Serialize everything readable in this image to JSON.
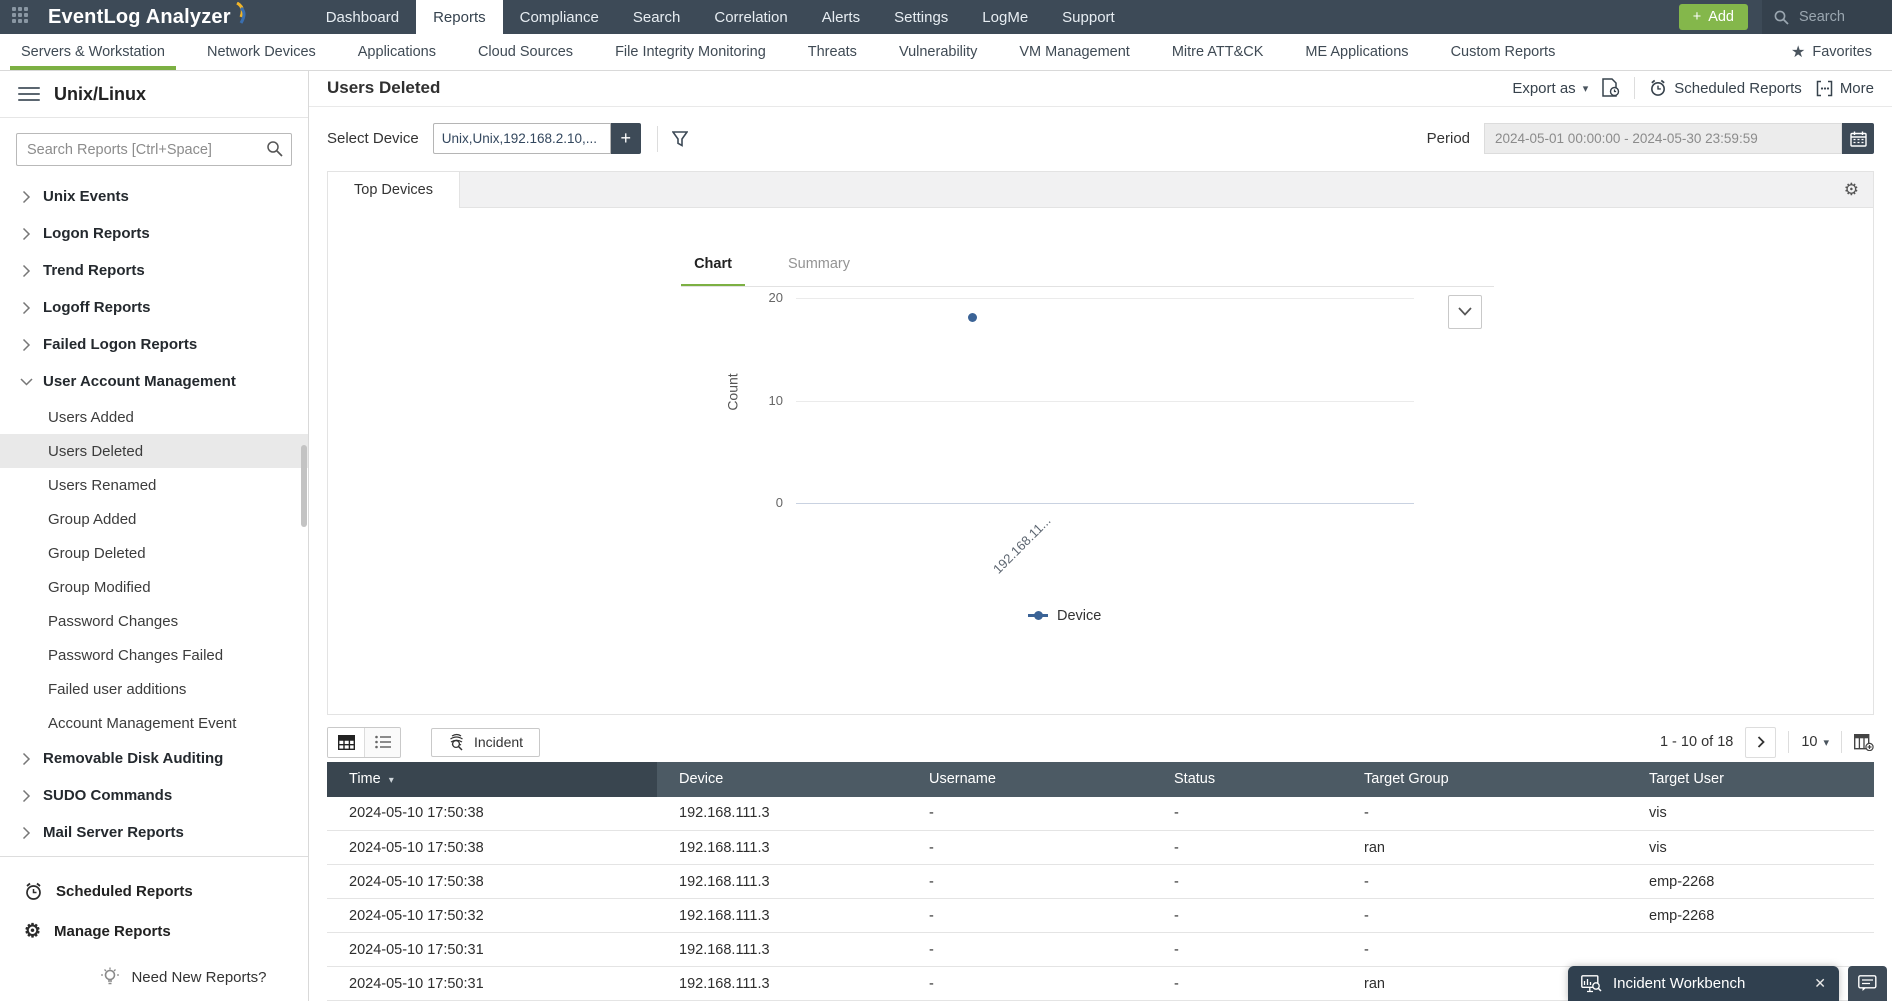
{
  "topbar": {
    "app_title": "EventLog Analyzer",
    "nav_items": [
      {
        "label": "Dashboard",
        "cls": ""
      },
      {
        "label": "Reports",
        "cls": "active"
      },
      {
        "label": "Compliance",
        "cls": ""
      },
      {
        "label": "Search",
        "cls": ""
      },
      {
        "label": "Correlation",
        "cls": ""
      },
      {
        "label": "Alerts",
        "cls": ""
      },
      {
        "label": "Settings",
        "cls": ""
      },
      {
        "label": "LogMe",
        "cls": ""
      },
      {
        "label": "Support",
        "cls": ""
      }
    ],
    "add_plus": "+",
    "add_label": "Add",
    "search_label": "Search"
  },
  "subnav": {
    "items": [
      {
        "label": "Servers & Workstation",
        "cls": "active"
      },
      {
        "label": "Network Devices",
        "cls": ""
      },
      {
        "label": "Applications",
        "cls": ""
      },
      {
        "label": "Cloud Sources",
        "cls": ""
      },
      {
        "label": "File Integrity Monitoring",
        "cls": ""
      },
      {
        "label": "Threats",
        "cls": ""
      },
      {
        "label": "Vulnerability",
        "cls": ""
      },
      {
        "label": "VM Management",
        "cls": ""
      },
      {
        "label": "Mitre ATT&CK",
        "cls": ""
      },
      {
        "label": "ME Applications",
        "cls": ""
      },
      {
        "label": "Custom Reports",
        "cls": ""
      }
    ],
    "favorites_label": "Favorites"
  },
  "sidebar": {
    "title": "Unix/Linux",
    "search_placeholder": "Search Reports [Ctrl+Space]",
    "items": [
      {
        "label": "Unix Events",
        "kind": "group"
      },
      {
        "label": "Logon Reports",
        "kind": "group"
      },
      {
        "label": "Trend Reports",
        "kind": "group"
      },
      {
        "label": "Logoff Reports",
        "kind": "group"
      },
      {
        "label": "Failed Logon Reports",
        "kind": "group"
      },
      {
        "label": "User Account Management",
        "kind": "group expanded"
      },
      {
        "label": "Users Added",
        "kind": "child"
      },
      {
        "label": "Users Deleted",
        "kind": "child selected"
      },
      {
        "label": "Users Renamed",
        "kind": "child"
      },
      {
        "label": "Group Added",
        "kind": "child"
      },
      {
        "label": "Group Deleted",
        "kind": "child"
      },
      {
        "label": "Group Modified",
        "kind": "child"
      },
      {
        "label": "Password Changes",
        "kind": "child"
      },
      {
        "label": "Password Changes Failed",
        "kind": "child"
      },
      {
        "label": "Failed user additions",
        "kind": "child"
      },
      {
        "label": "Account Management Event",
        "kind": "child"
      },
      {
        "label": "Removable Disk Auditing",
        "kind": "group"
      },
      {
        "label": "SUDO Commands",
        "kind": "group"
      },
      {
        "label": "Mail Server Reports",
        "kind": "group"
      }
    ],
    "footer": {
      "scheduled": "Scheduled Reports",
      "manage": "Manage Reports",
      "need_new": "Need New Reports?"
    }
  },
  "report": {
    "title": "Users Deleted",
    "export_as": "Export as",
    "scheduled_reports": "Scheduled Reports",
    "more": "More",
    "select_device_label": "Select Device",
    "device_value": "Unix,Unix,192.168.2.10,...",
    "period_label": "Period",
    "period_value": "2024-05-01 00:00:00 - 2024-05-30 23:59:59"
  },
  "panel": {
    "tab": "Top Devices",
    "chart_tab": "Chart",
    "summary_tab": "Summary"
  },
  "chart_data": {
    "type": "scatter",
    "title": "Top Devices",
    "categories": [
      "192.168.11..."
    ],
    "series": [
      {
        "name": "Device",
        "values": [
          18
        ]
      }
    ],
    "ylabel": "Count",
    "yticks": [
      "20",
      "10",
      "0"
    ],
    "ylim": [
      0,
      22
    ],
    "grid": true,
    "legend_position": "bottom"
  },
  "toolbar": {
    "incident_label": "Incident",
    "pagination_range": "1 - 10 of 18",
    "page_size": "10"
  },
  "table": {
    "columns": [
      "Time",
      "Device",
      "Username",
      "Status",
      "Target Group",
      "Target User"
    ],
    "rows": [
      {
        "time": "2024-05-10 17:50:38",
        "device": "192.168.111.3",
        "username": "-",
        "status": "-",
        "target_group": "-",
        "target_user": "vis"
      },
      {
        "time": "2024-05-10 17:50:38",
        "device": "192.168.111.3",
        "username": "-",
        "status": "-",
        "target_group": "ran",
        "target_user": "vis"
      },
      {
        "time": "2024-05-10 17:50:38",
        "device": "192.168.111.3",
        "username": "-",
        "status": "-",
        "target_group": "-",
        "target_user": "emp-2268"
      },
      {
        "time": "2024-05-10 17:50:32",
        "device": "192.168.111.3",
        "username": "-",
        "status": "-",
        "target_group": "-",
        "target_user": "emp-2268"
      },
      {
        "time": "2024-05-10 17:50:31",
        "device": "192.168.111.3",
        "username": "-",
        "status": "-",
        "target_group": "-",
        "target_user": ""
      },
      {
        "time": "2024-05-10 17:50:31",
        "device": "192.168.111.3",
        "username": "-",
        "status": "-",
        "target_group": "ran",
        "target_user": ""
      }
    ]
  },
  "workbench": {
    "label": "Incident Workbench"
  }
}
